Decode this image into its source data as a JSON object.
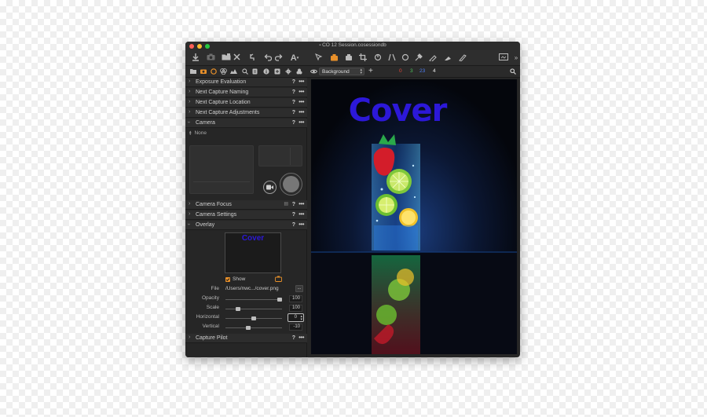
{
  "window": {
    "title": "CO 12 Session.cosessiondb"
  },
  "traffic_lights": {
    "close_color": "#ff5f57",
    "minimize_color": "#febc2e",
    "zoom_color": "#28c840"
  },
  "toolbar": {
    "left_icons": [
      "import-icon",
      "camera-icon",
      "folder-camera-icon",
      "delete-icon",
      "revert-icon",
      "undo-icon",
      "redo-icon",
      "text-icon"
    ],
    "center_icons": [
      "select-cursor-icon",
      "pan-tool-icon",
      "camera-tool-icon",
      "crop-icon",
      "rotate-icon",
      "keystone-icon",
      "circle-icon",
      "picker-icon",
      "brush-icon",
      "eraser-icon",
      "pen-icon"
    ],
    "right_icons": [
      "viewer-icon",
      "expand-icon"
    ],
    "text_tool_glyph": "A"
  },
  "tool_tabs": [
    "library-icon",
    "capture-icon",
    "lens-icon",
    "color-icon",
    "exposure-icon",
    "details-icon",
    "adjustments-icon",
    "metadata-icon",
    "output-icon",
    "batch-icon",
    "styles-icon"
  ],
  "viewer_bar": {
    "layer_select": "Background",
    "counts": {
      "red": "0",
      "green": "3",
      "blue": "23",
      "white": "4"
    },
    "count_colors": {
      "red": "#e0463a",
      "green": "#4cc25a",
      "blue": "#4d7cf0",
      "white": "#e8e8e8"
    }
  },
  "sections": {
    "exposure_evaluation": "Exposure Evaluation",
    "next_capture_naming": "Next Capture Naming",
    "next_capture_location": "Next Capture Location",
    "next_capture_adjustments": "Next Capture Adjustments",
    "camera": "Camera",
    "camera_focus": "Camera Focus",
    "camera_settings": "Camera Settings",
    "overlay": "Overlay",
    "capture_pilot": "Capture Pilot",
    "help_glyph": "?",
    "more_glyph": "•••"
  },
  "camera": {
    "selected_camera": "None"
  },
  "overlay": {
    "preview_text": "Cover",
    "show_label": "Show",
    "show_checked": true,
    "file_label": "File",
    "file_path": "/Users/nwc.../cover.png",
    "browse_label": "...",
    "opacity_label": "Opacity",
    "opacity_value": "100",
    "opacity_fraction": 1.0,
    "scale_label": "Scale",
    "scale_value": "100",
    "scale_fraction": 0.2,
    "horizontal_label": "Horizontal",
    "horizontal_value": "0",
    "horizontal_fraction": 0.5,
    "vertical_label": "Vertical",
    "vertical_value": "-10",
    "vertical_fraction": 0.4
  },
  "image": {
    "overlay_text": "Cover",
    "overlay_color": "#2c18d8",
    "background_color": "#06080e"
  }
}
